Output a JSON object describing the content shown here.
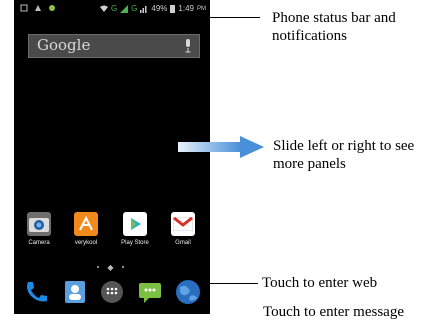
{
  "status_bar": {
    "battery_percent": "49%",
    "time": "1:49",
    "ampm": "PM",
    "network_label": "G"
  },
  "search": {
    "label": "Google"
  },
  "apps": [
    {
      "label": "Camera",
      "icon": "camera-icon",
      "color": "#3a86c8"
    },
    {
      "label": "verykool",
      "icon": "verykool-icon",
      "color": "#f08a1c"
    },
    {
      "label": "Play Store",
      "icon": "play-store-icon",
      "color": "#ffffff"
    },
    {
      "label": "Gmail",
      "icon": "gmail-icon",
      "color": "#ffffff"
    }
  ],
  "dock": [
    {
      "icon": "phone-icon",
      "color": "#1e88e5"
    },
    {
      "icon": "contacts-icon",
      "color": "#5aa0e0"
    },
    {
      "icon": "app-drawer-icon",
      "color": "#555555"
    },
    {
      "icon": "messaging-icon",
      "color": "#7bc043"
    },
    {
      "icon": "browser-icon",
      "color": "#2a6fbf"
    }
  ],
  "annotations": {
    "status_bar": "Phone status bar and notifications",
    "swipe": "Slide left or right to see more panels",
    "web": "Touch to enter web",
    "message": "Touch to enter message"
  }
}
